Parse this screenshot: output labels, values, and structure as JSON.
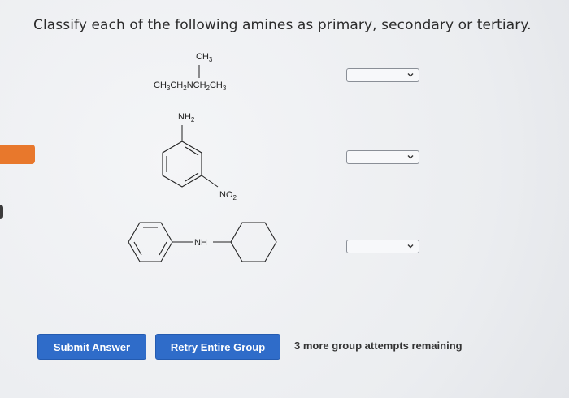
{
  "question": "Classify each of the following amines as primary, secondary or tertiary.",
  "structures": {
    "s1": {
      "top": "CH",
      "top_sub": "3",
      "chain": [
        {
          "t": "CH",
          "s": "3"
        },
        {
          "t": "CH",
          "s": "2"
        },
        {
          "t": "NCH",
          "s": "2"
        },
        {
          "t": "CH",
          "s": "3"
        }
      ]
    },
    "s2": {
      "top": "NH",
      "top_sub": "2",
      "sub": "NO",
      "sub_sub": "2"
    },
    "s3": {
      "link": "NH"
    }
  },
  "selects": [
    {
      "value": ""
    },
    {
      "value": ""
    },
    {
      "value": ""
    }
  ],
  "buttons": {
    "submit": "Submit Answer",
    "retry": "Retry Entire Group"
  },
  "status": "3 more group attempts remaining",
  "colors": {
    "button": "#2f6cc9",
    "accent_tab": "#e8782c"
  }
}
